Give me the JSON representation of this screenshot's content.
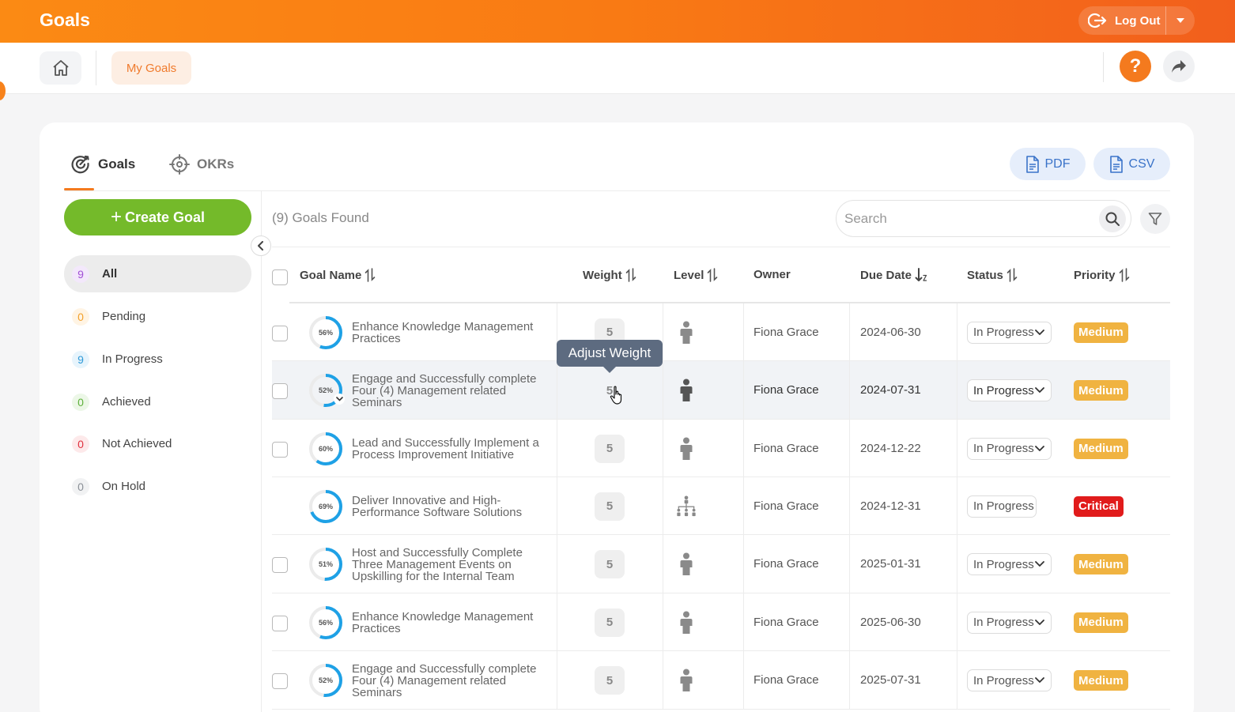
{
  "app": {
    "title": "Goals",
    "logout_label": "Log Out"
  },
  "breadcrumb": {
    "current": "My Goals"
  },
  "help": {
    "label": "?"
  },
  "tabs": [
    {
      "label": "Goals"
    },
    {
      "label": "OKRs"
    }
  ],
  "export": {
    "pdf_label": "PDF",
    "csv_label": "CSV"
  },
  "sidebar": {
    "create_label": "Create Goal",
    "filters": [
      {
        "count": "9",
        "label": "All",
        "color": "#a24fd6",
        "bg": "#f3e8fb"
      },
      {
        "count": "0",
        "label": "Pending",
        "color": "#f3a02a",
        "bg": "#fff4e4"
      },
      {
        "count": "9",
        "label": "In Progress",
        "color": "#2f9ad8",
        "bg": "#e7f4fc"
      },
      {
        "count": "0",
        "label": "Achieved",
        "color": "#5fb13b",
        "bg": "#ecf7e7"
      },
      {
        "count": "0",
        "label": "Not Achieved",
        "color": "#e0313f",
        "bg": "#fde9ea"
      },
      {
        "count": "0",
        "label": "On Hold",
        "color": "#8a8f96",
        "bg": "#f1f2f3"
      }
    ]
  },
  "summary": {
    "found_label": "(9) Goals Found"
  },
  "search": {
    "placeholder": "Search",
    "value": ""
  },
  "columns": {
    "goal_name": "Goal Name",
    "weight": "Weight",
    "level": "Level",
    "owner": "Owner",
    "due_date": "Due Date",
    "status": "Status",
    "priority": "Priority"
  },
  "tooltip": {
    "label": "Adjust Weight"
  },
  "colors": {
    "accent": "#f47a1e",
    "progress": "#1ea1e6",
    "medium": "#f0b341",
    "critical": "#e11b1b"
  },
  "rows": [
    {
      "progress": 56,
      "progress_label": "56%",
      "name": "Enhance Knowledge Management Practices",
      "weight": "5",
      "level": "person",
      "owner": "Fiona Grace",
      "due": "2024-06-30",
      "status": "In Progress",
      "status_dropdown": true,
      "priority": "Medium",
      "checkbox": true,
      "expandable": false
    },
    {
      "progress": 52,
      "progress_label": "52%",
      "name": "Engage and Successfully complete Four (4) Management related Seminars",
      "weight": "5",
      "level": "person",
      "owner": "Fiona Grace",
      "due": "2024-07-31",
      "status": "In Progress",
      "status_dropdown": true,
      "priority": "Medium",
      "checkbox": true,
      "expandable": true
    },
    {
      "progress": 60,
      "progress_label": "60%",
      "name": "Lead and Successfully Implement a Process Improvement Initiative",
      "weight": "5",
      "level": "person",
      "owner": "Fiona Grace",
      "due": "2024-12-22",
      "status": "In Progress",
      "status_dropdown": true,
      "priority": "Medium",
      "checkbox": true,
      "expandable": false
    },
    {
      "progress": 69,
      "progress_label": "69%",
      "name": "Deliver Innovative and High-Performance Software Solutions",
      "weight": "5",
      "level": "hierarchy",
      "owner": "Fiona Grace",
      "due": "2024-12-31",
      "status": "In Progress",
      "status_dropdown": false,
      "priority": "Critical",
      "checkbox": false,
      "expandable": false
    },
    {
      "progress": 51,
      "progress_label": "51%",
      "name": "Host and Successfully Complete Three Management Events on Upskilling for the Internal Team",
      "weight": "5",
      "level": "person",
      "owner": "Fiona Grace",
      "due": "2025-01-31",
      "status": "In Progress",
      "status_dropdown": true,
      "priority": "Medium",
      "checkbox": true,
      "expandable": false
    },
    {
      "progress": 56,
      "progress_label": "56%",
      "name": "Enhance Knowledge Management Practices",
      "weight": "5",
      "level": "person",
      "owner": "Fiona Grace",
      "due": "2025-06-30",
      "status": "In Progress",
      "status_dropdown": true,
      "priority": "Medium",
      "checkbox": true,
      "expandable": false
    },
    {
      "progress": 52,
      "progress_label": "52%",
      "name": "Engage and Successfully complete Four (4) Management related Seminars",
      "weight": "5",
      "level": "person",
      "owner": "Fiona Grace",
      "due": "2025-07-31",
      "status": "In Progress",
      "status_dropdown": true,
      "priority": "Medium",
      "checkbox": true,
      "expandable": false
    }
  ]
}
